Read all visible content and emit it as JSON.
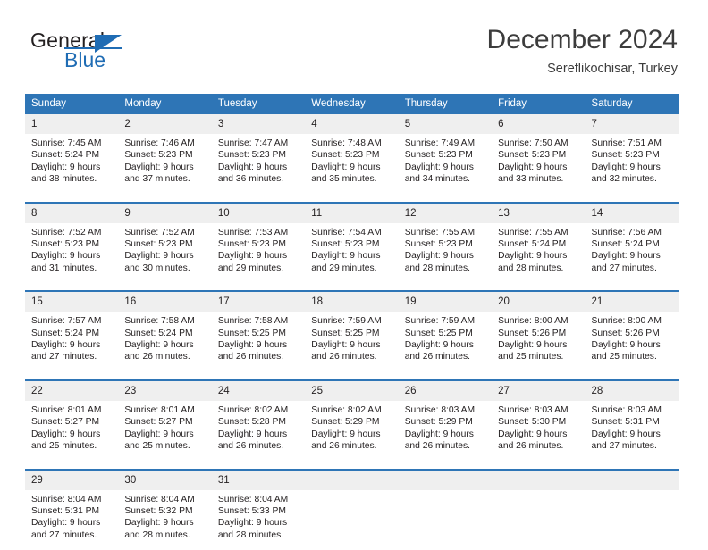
{
  "brand": {
    "name_top": "General",
    "name_bottom": "Blue",
    "accent_color": "#1f6cb4"
  },
  "header": {
    "title": "December 2024",
    "subtitle": "Sereflikochisar, Turkey"
  },
  "calendar": {
    "header_color": "#2e75b6",
    "daynum_bg": "#efefef",
    "weekday_headers": [
      "Sunday",
      "Monday",
      "Tuesday",
      "Wednesday",
      "Thursday",
      "Friday",
      "Saturday"
    ],
    "weeks": [
      [
        {
          "day": "1",
          "sunrise": "Sunrise: 7:45 AM",
          "sunset": "Sunset: 5:24 PM",
          "daylight1": "Daylight: 9 hours",
          "daylight2": "and 38 minutes."
        },
        {
          "day": "2",
          "sunrise": "Sunrise: 7:46 AM",
          "sunset": "Sunset: 5:23 PM",
          "daylight1": "Daylight: 9 hours",
          "daylight2": "and 37 minutes."
        },
        {
          "day": "3",
          "sunrise": "Sunrise: 7:47 AM",
          "sunset": "Sunset: 5:23 PM",
          "daylight1": "Daylight: 9 hours",
          "daylight2": "and 36 minutes."
        },
        {
          "day": "4",
          "sunrise": "Sunrise: 7:48 AM",
          "sunset": "Sunset: 5:23 PM",
          "daylight1": "Daylight: 9 hours",
          "daylight2": "and 35 minutes."
        },
        {
          "day": "5",
          "sunrise": "Sunrise: 7:49 AM",
          "sunset": "Sunset: 5:23 PM",
          "daylight1": "Daylight: 9 hours",
          "daylight2": "and 34 minutes."
        },
        {
          "day": "6",
          "sunrise": "Sunrise: 7:50 AM",
          "sunset": "Sunset: 5:23 PM",
          "daylight1": "Daylight: 9 hours",
          "daylight2": "and 33 minutes."
        },
        {
          "day": "7",
          "sunrise": "Sunrise: 7:51 AM",
          "sunset": "Sunset: 5:23 PM",
          "daylight1": "Daylight: 9 hours",
          "daylight2": "and 32 minutes."
        }
      ],
      [
        {
          "day": "8",
          "sunrise": "Sunrise: 7:52 AM",
          "sunset": "Sunset: 5:23 PM",
          "daylight1": "Daylight: 9 hours",
          "daylight2": "and 31 minutes."
        },
        {
          "day": "9",
          "sunrise": "Sunrise: 7:52 AM",
          "sunset": "Sunset: 5:23 PM",
          "daylight1": "Daylight: 9 hours",
          "daylight2": "and 30 minutes."
        },
        {
          "day": "10",
          "sunrise": "Sunrise: 7:53 AM",
          "sunset": "Sunset: 5:23 PM",
          "daylight1": "Daylight: 9 hours",
          "daylight2": "and 29 minutes."
        },
        {
          "day": "11",
          "sunrise": "Sunrise: 7:54 AM",
          "sunset": "Sunset: 5:23 PM",
          "daylight1": "Daylight: 9 hours",
          "daylight2": "and 29 minutes."
        },
        {
          "day": "12",
          "sunrise": "Sunrise: 7:55 AM",
          "sunset": "Sunset: 5:23 PM",
          "daylight1": "Daylight: 9 hours",
          "daylight2": "and 28 minutes."
        },
        {
          "day": "13",
          "sunrise": "Sunrise: 7:55 AM",
          "sunset": "Sunset: 5:24 PM",
          "daylight1": "Daylight: 9 hours",
          "daylight2": "and 28 minutes."
        },
        {
          "day": "14",
          "sunrise": "Sunrise: 7:56 AM",
          "sunset": "Sunset: 5:24 PM",
          "daylight1": "Daylight: 9 hours",
          "daylight2": "and 27 minutes."
        }
      ],
      [
        {
          "day": "15",
          "sunrise": "Sunrise: 7:57 AM",
          "sunset": "Sunset: 5:24 PM",
          "daylight1": "Daylight: 9 hours",
          "daylight2": "and 27 minutes."
        },
        {
          "day": "16",
          "sunrise": "Sunrise: 7:58 AM",
          "sunset": "Sunset: 5:24 PM",
          "daylight1": "Daylight: 9 hours",
          "daylight2": "and 26 minutes."
        },
        {
          "day": "17",
          "sunrise": "Sunrise: 7:58 AM",
          "sunset": "Sunset: 5:25 PM",
          "daylight1": "Daylight: 9 hours",
          "daylight2": "and 26 minutes."
        },
        {
          "day": "18",
          "sunrise": "Sunrise: 7:59 AM",
          "sunset": "Sunset: 5:25 PM",
          "daylight1": "Daylight: 9 hours",
          "daylight2": "and 26 minutes."
        },
        {
          "day": "19",
          "sunrise": "Sunrise: 7:59 AM",
          "sunset": "Sunset: 5:25 PM",
          "daylight1": "Daylight: 9 hours",
          "daylight2": "and 26 minutes."
        },
        {
          "day": "20",
          "sunrise": "Sunrise: 8:00 AM",
          "sunset": "Sunset: 5:26 PM",
          "daylight1": "Daylight: 9 hours",
          "daylight2": "and 25 minutes."
        },
        {
          "day": "21",
          "sunrise": "Sunrise: 8:00 AM",
          "sunset": "Sunset: 5:26 PM",
          "daylight1": "Daylight: 9 hours",
          "daylight2": "and 25 minutes."
        }
      ],
      [
        {
          "day": "22",
          "sunrise": "Sunrise: 8:01 AM",
          "sunset": "Sunset: 5:27 PM",
          "daylight1": "Daylight: 9 hours",
          "daylight2": "and 25 minutes."
        },
        {
          "day": "23",
          "sunrise": "Sunrise: 8:01 AM",
          "sunset": "Sunset: 5:27 PM",
          "daylight1": "Daylight: 9 hours",
          "daylight2": "and 25 minutes."
        },
        {
          "day": "24",
          "sunrise": "Sunrise: 8:02 AM",
          "sunset": "Sunset: 5:28 PM",
          "daylight1": "Daylight: 9 hours",
          "daylight2": "and 26 minutes."
        },
        {
          "day": "25",
          "sunrise": "Sunrise: 8:02 AM",
          "sunset": "Sunset: 5:29 PM",
          "daylight1": "Daylight: 9 hours",
          "daylight2": "and 26 minutes."
        },
        {
          "day": "26",
          "sunrise": "Sunrise: 8:03 AM",
          "sunset": "Sunset: 5:29 PM",
          "daylight1": "Daylight: 9 hours",
          "daylight2": "and 26 minutes."
        },
        {
          "day": "27",
          "sunrise": "Sunrise: 8:03 AM",
          "sunset": "Sunset: 5:30 PM",
          "daylight1": "Daylight: 9 hours",
          "daylight2": "and 26 minutes."
        },
        {
          "day": "28",
          "sunrise": "Sunrise: 8:03 AM",
          "sunset": "Sunset: 5:31 PM",
          "daylight1": "Daylight: 9 hours",
          "daylight2": "and 27 minutes."
        }
      ],
      [
        {
          "day": "29",
          "sunrise": "Sunrise: 8:04 AM",
          "sunset": "Sunset: 5:31 PM",
          "daylight1": "Daylight: 9 hours",
          "daylight2": "and 27 minutes."
        },
        {
          "day": "30",
          "sunrise": "Sunrise: 8:04 AM",
          "sunset": "Sunset: 5:32 PM",
          "daylight1": "Daylight: 9 hours",
          "daylight2": "and 28 minutes."
        },
        {
          "day": "31",
          "sunrise": "Sunrise: 8:04 AM",
          "sunset": "Sunset: 5:33 PM",
          "daylight1": "Daylight: 9 hours",
          "daylight2": "and 28 minutes."
        },
        {
          "day": "",
          "sunrise": "",
          "sunset": "",
          "daylight1": "",
          "daylight2": "",
          "empty": true
        },
        {
          "day": "",
          "sunrise": "",
          "sunset": "",
          "daylight1": "",
          "daylight2": "",
          "empty": true
        },
        {
          "day": "",
          "sunrise": "",
          "sunset": "",
          "daylight1": "",
          "daylight2": "",
          "empty": true
        },
        {
          "day": "",
          "sunrise": "",
          "sunset": "",
          "daylight1": "",
          "daylight2": "",
          "empty": true
        }
      ]
    ]
  }
}
